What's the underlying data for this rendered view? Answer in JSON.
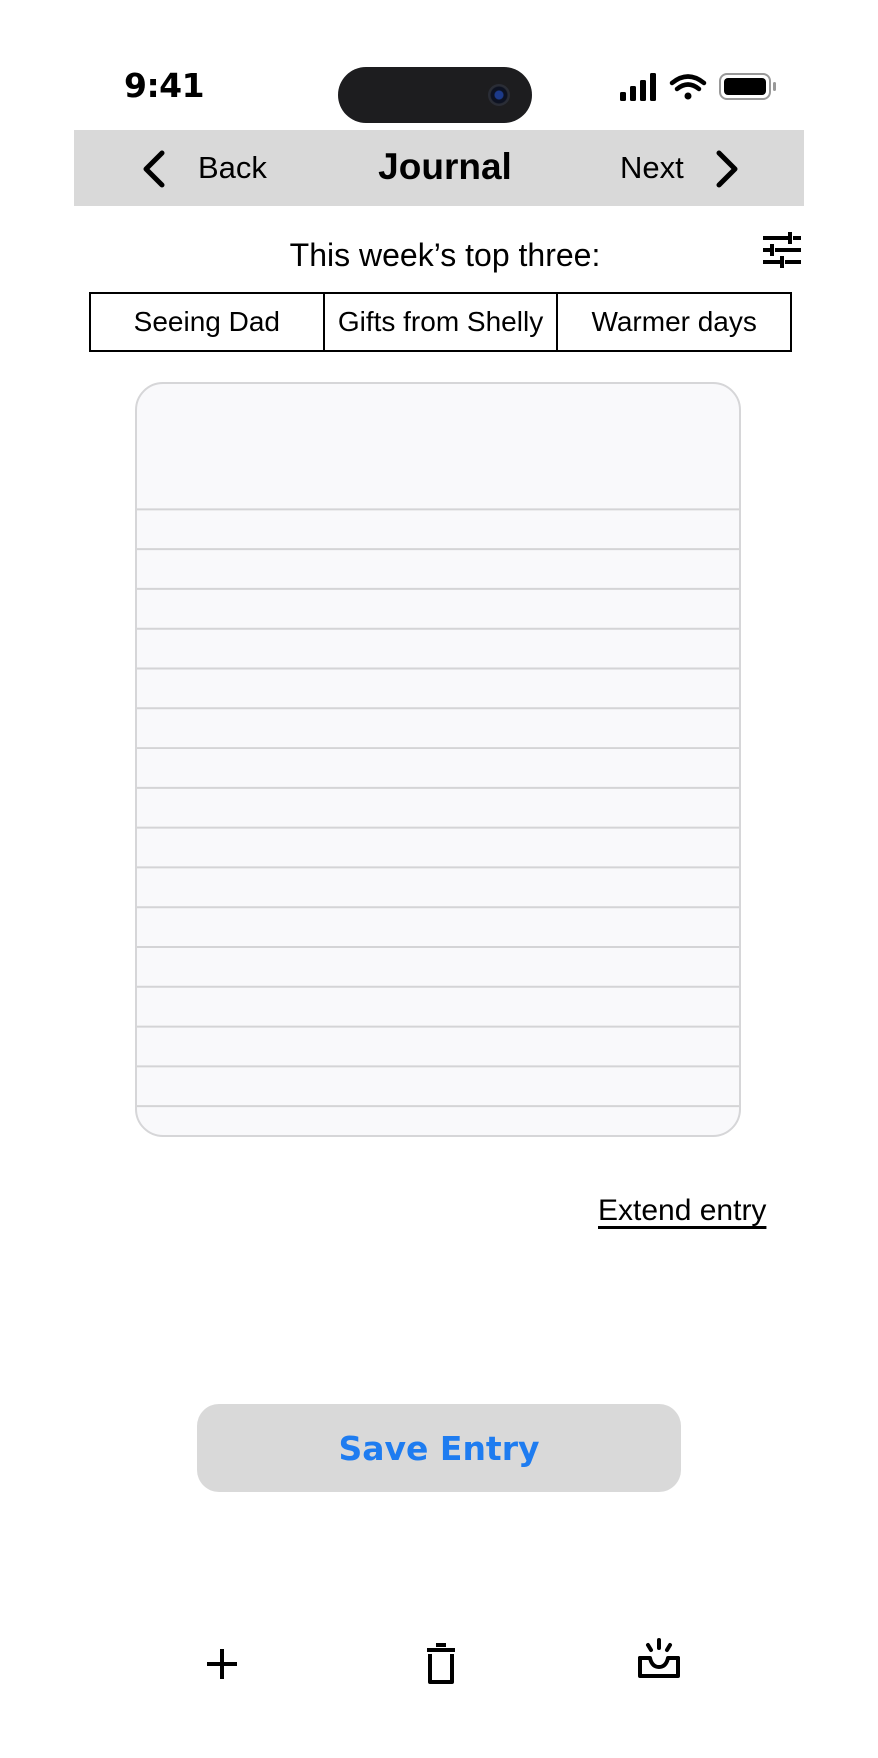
{
  "status_bar": {
    "time": "9:41",
    "icons": [
      "cellular-signal-icon",
      "wifi-icon",
      "battery-icon"
    ]
  },
  "nav": {
    "back_label": "Back",
    "title": "Journal",
    "next_label": "Next",
    "back_icon": "chevron-left-icon",
    "next_icon": "chevron-right-icon"
  },
  "top_three": {
    "label": "This week’s top three:",
    "filter_icon": "sliders-icon",
    "items": [
      "Seeing Dad",
      "Gifts from Shelly",
      "Warmer days"
    ]
  },
  "entry": {
    "text": "",
    "extend_label": "Extend entry"
  },
  "save_button": {
    "label": "Save Entry"
  },
  "tab_bar": {
    "icons": [
      "plus-icon",
      "trash-icon",
      "inbox-icon"
    ]
  },
  "colors": {
    "accent": "#1e7cf0",
    "nav_background": "#d9d9d9",
    "button_background": "#d9d9d9",
    "paper_background": "#f9f9fb",
    "paper_line": "#d4d4d6"
  }
}
